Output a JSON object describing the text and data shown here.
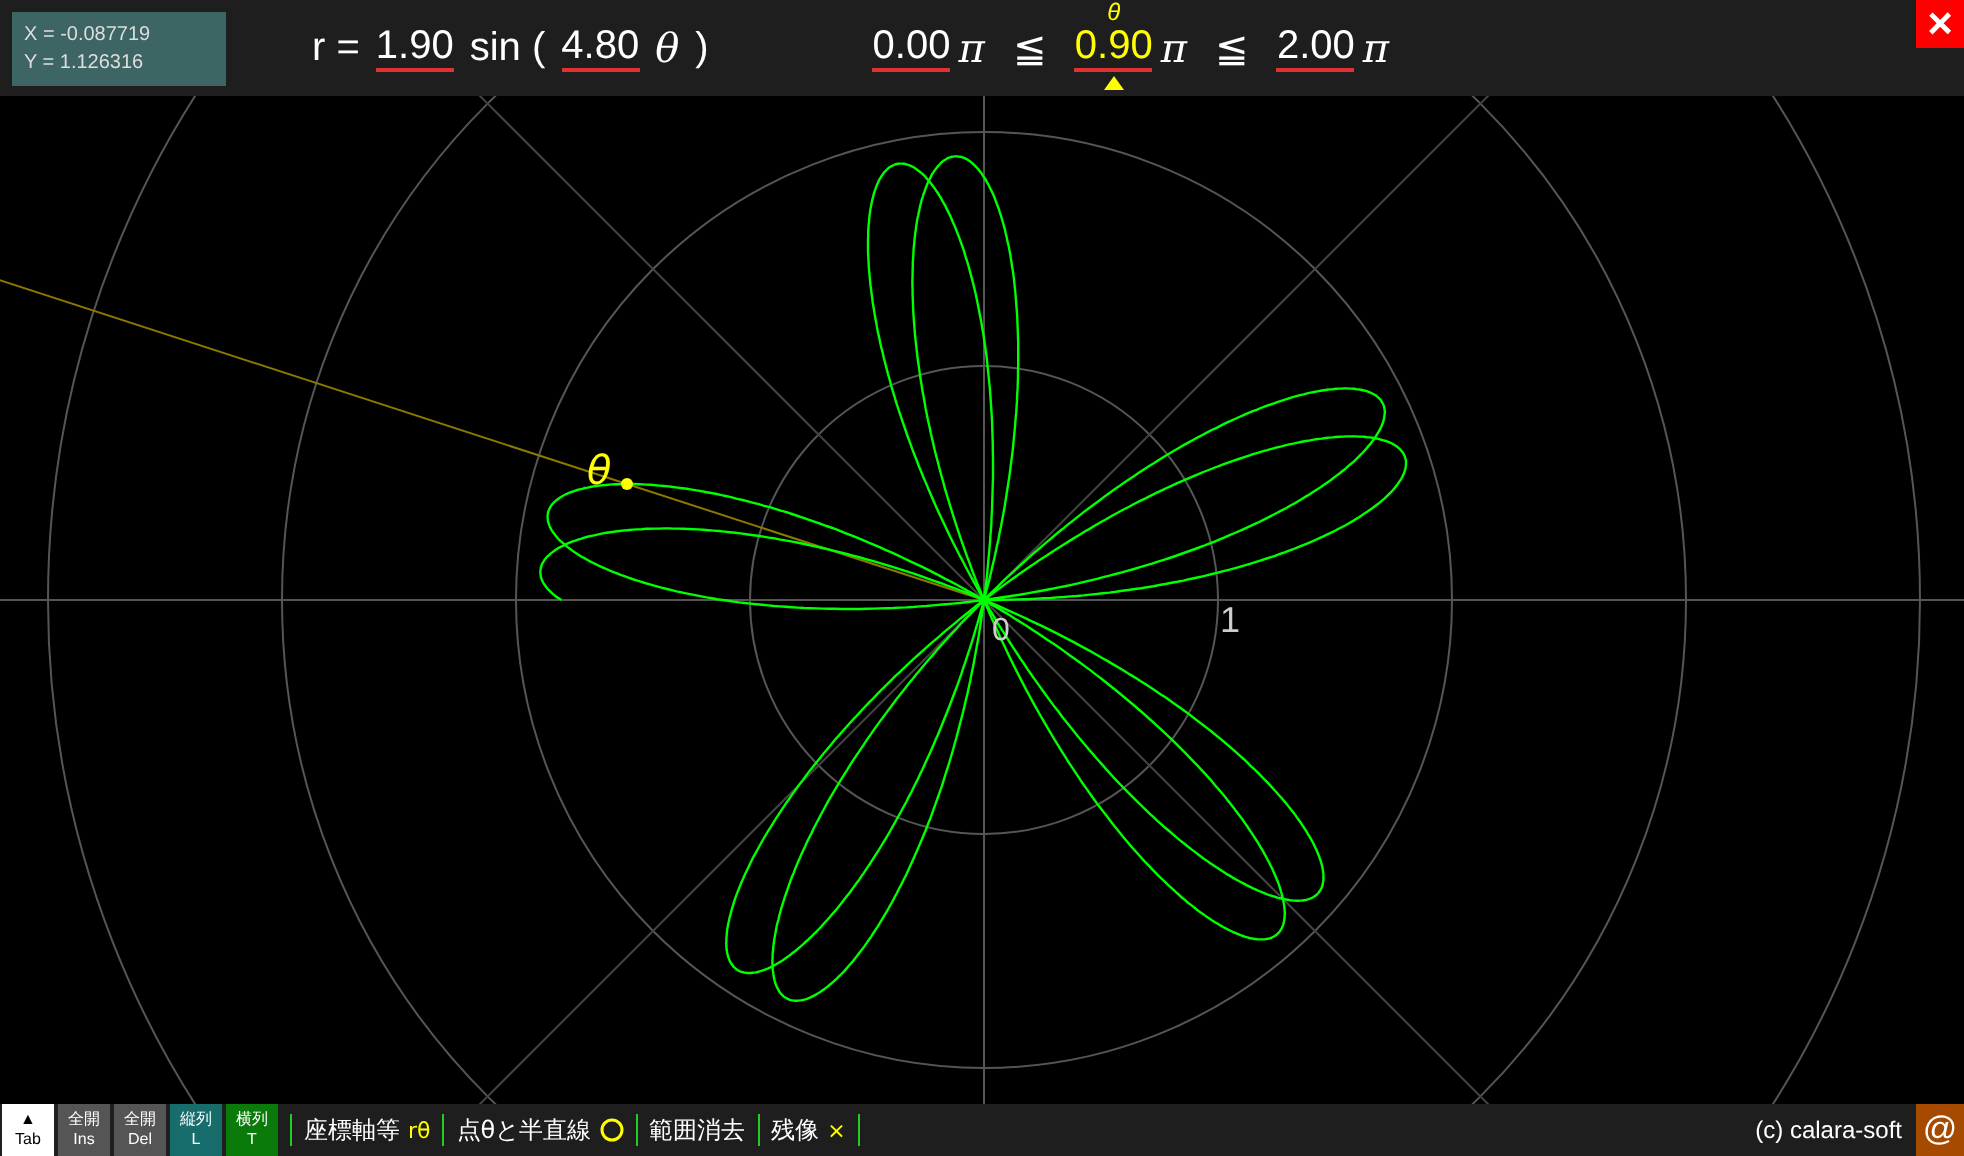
{
  "readout": {
    "x": "X = -0.087719",
    "y": "Y = 1.126316"
  },
  "equation": {
    "r": "r =",
    "amplitude": "1.90",
    "func": "sin (",
    "frequency": "4.80",
    "variable": "θ",
    "close": ")"
  },
  "range": {
    "start": "0.00",
    "pi_1": "π",
    "le_1": "≦",
    "theta_label": "θ",
    "current": "0.90",
    "pi_2": "π",
    "le_2": "≦",
    "end": "2.00",
    "pi_3": "π"
  },
  "close_button": "×",
  "plot": {
    "unit_label": "1",
    "origin_label": "0",
    "point_label": "θ"
  },
  "buttons": [
    {
      "top": "▲",
      "bottom": "Tab",
      "kind": "light"
    },
    {
      "top": "全開",
      "bottom": "Ins",
      "kind": "grey"
    },
    {
      "top": "全開",
      "bottom": "Del",
      "kind": "grey"
    },
    {
      "top": "縦列",
      "bottom": "L",
      "kind": "teal"
    },
    {
      "top": "横列",
      "bottom": "T",
      "kind": "green"
    }
  ],
  "toolbar": [
    {
      "label": "座標軸等",
      "suffix": "rθ",
      "kind": "text"
    },
    {
      "label": "点θと半直線",
      "kind": "circle"
    },
    {
      "label": "範囲消去",
      "kind": "none"
    },
    {
      "label": "残像",
      "suffix": "×",
      "kind": "text"
    }
  ],
  "copyright": "(c) calara-soft",
  "at_button": "@"
}
